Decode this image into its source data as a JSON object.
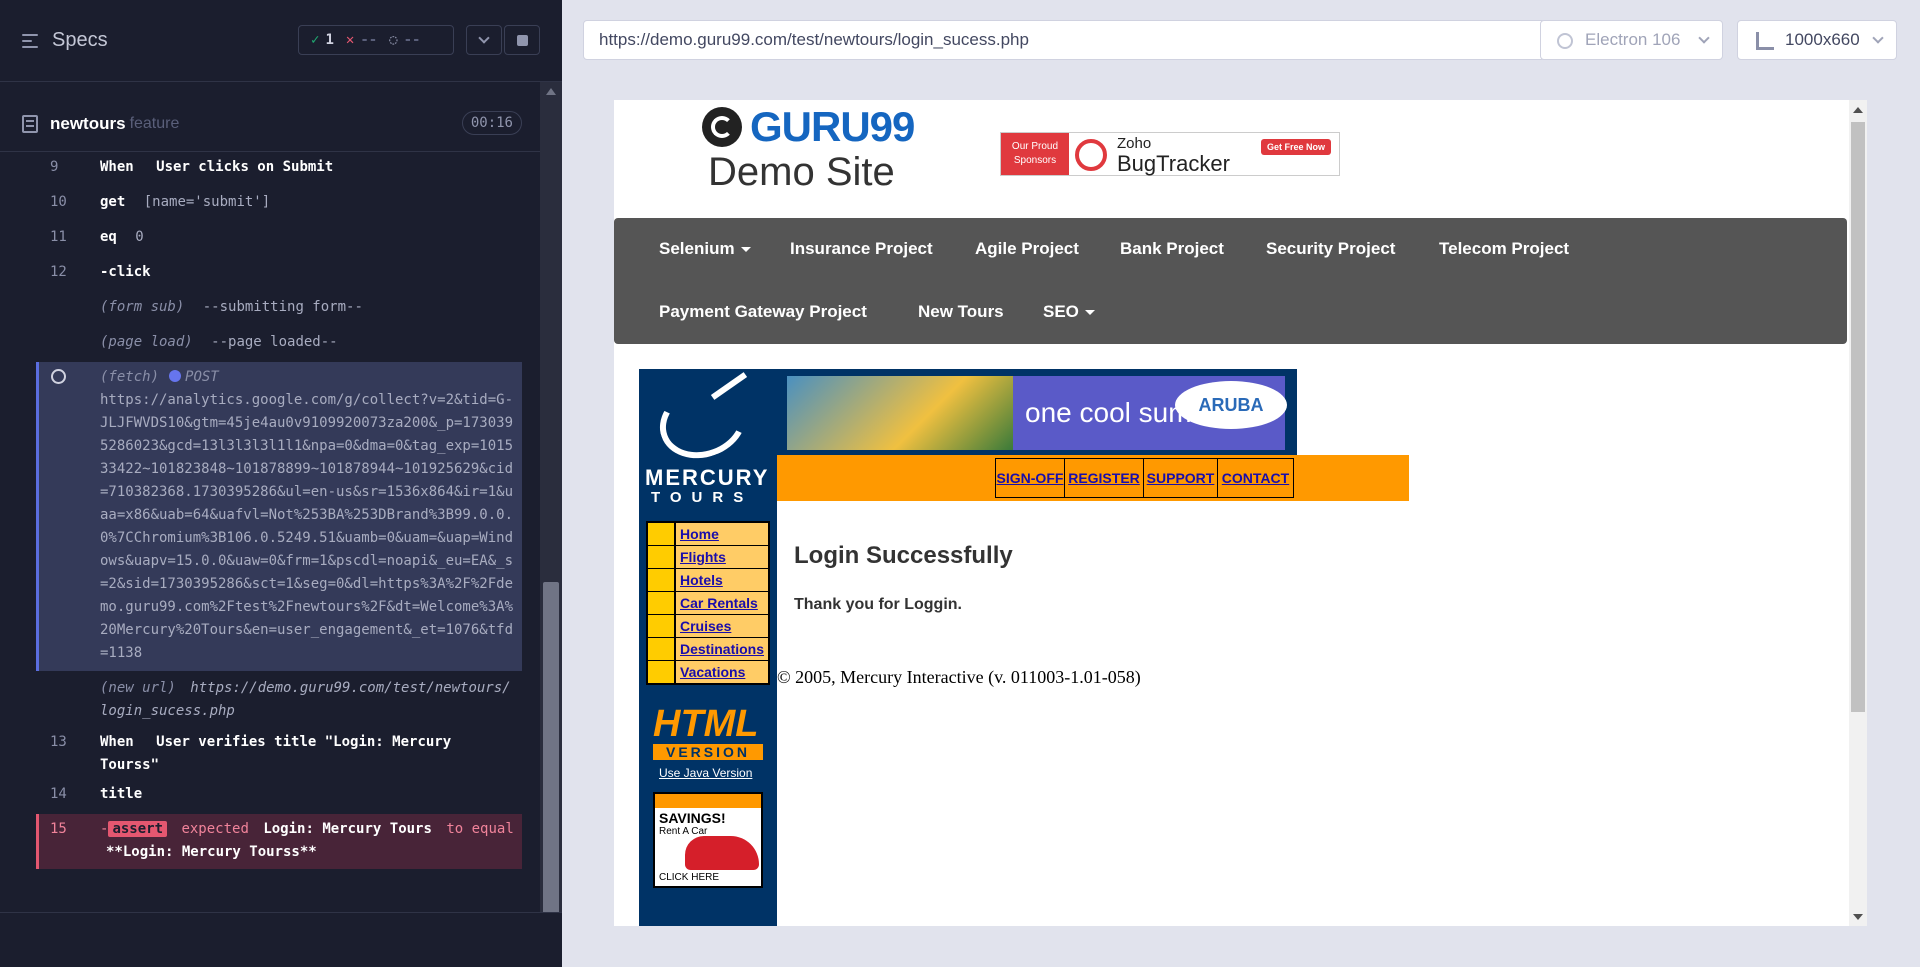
{
  "reporter": {
    "title": "Specs",
    "stats": {
      "passed": "1",
      "failed": "--",
      "pending": "--"
    },
    "spec": {
      "name": "newtours",
      "ext": "feature",
      "duration": "00:16"
    },
    "commands": [
      {
        "num": "9",
        "name": "When",
        "arg": "User clicks on Submit"
      },
      {
        "num": "10",
        "name": "get",
        "arg": "[name='submit']"
      },
      {
        "num": "11",
        "name": "eq",
        "arg": "0"
      },
      {
        "num": "12",
        "name": "-click",
        "arg": ""
      },
      {
        "label": "(form sub)",
        "arg": "--submitting form--"
      },
      {
        "label": "(page load)",
        "arg": "--page loaded--"
      }
    ],
    "fetch": {
      "label": "(fetch)",
      "method": "POST",
      "url": "https://analytics.google.com/g/collect?v=2&tid=G-JLJFWVDS10&gtm=45je4au0v9109920073za200&_p=1730395286023&gcd=13l3l3l3l1l1&npa=0&dma=0&tag_exp=101533422~101823848~101878899~101878944~101925629&cid=710382368.1730395286&ul=en-us&sr=1536x864&ir=1&uaa=x86&uab=64&uafvl=Not%253BA%253DBrand%3B99.0.0.0%7CChromium%3B106.0.5249.51&uamb=0&uam=&uap=Windows&uapv=15.0.0&uaw=0&frm=1&pscdl=noapi&_eu=EA&_s=2&sid=1730395286&sct=1&seg=0&dl=https%3A%2F%2Fdemo.guru99.com%2Ftest%2Fnewtours%2F&dt=Welcome%3A%20Mercury%20Tours&en=user_engagement&_et=1076&tfd=1138"
    },
    "new_url": {
      "label": "(new url)",
      "url": "https://demo.guru99.com/test/newtours/login_sucess.php"
    },
    "commands2": [
      {
        "num": "13",
        "name": "When",
        "arg": "User verifies title \"Login: Mercury Tourss\""
      },
      {
        "num": "14",
        "name": "title",
        "arg": ""
      }
    ],
    "assert": {
      "num": "15",
      "badge": "assert",
      "t1": "expected",
      "t2": "Login: Mercury Tours",
      "t3": "to equal",
      "t4": "**Login: Mercury Tourss**"
    }
  },
  "aut": {
    "url": "https://demo.guru99.com/test/newtours/login_sucess.php",
    "browser": "Electron 106",
    "viewport": "1000x660"
  },
  "site": {
    "logo": "GURU99",
    "demo": "Demo Site",
    "sponsor": {
      "proud": "Our Proud Sponsors",
      "z1": "Zoho",
      "z2": "BugTracker",
      "cta": "Get Free Now"
    },
    "nav": {
      "selenium": "Selenium",
      "insurance": "Insurance Project",
      "agile": "Agile Project",
      "bank": "Bank Project",
      "security": "Security Project",
      "telecom": "Telecom Project",
      "payment": "Payment Gateway Project",
      "newtours": "New Tours",
      "seo": "SEO"
    },
    "mercury": {
      "logo1": "MERCURY",
      "logo2": "TOURS",
      "banner": "one cool summer",
      "aruba": "ARUBA",
      "top_links": {
        "signoff": "SIGN-OFF",
        "register": "REGISTER",
        "support": "SUPPORT",
        "contact": "CONTACT"
      },
      "side_links": {
        "home": "Home",
        "flights": "Flights",
        "hotels": "Hotels",
        "car": "Car Rentals",
        "cruises": "Cruises",
        "dest": "Destinations",
        "vacations": "Vacations"
      },
      "html1": "HTML",
      "html2": "VERSION",
      "java": "Use Java Version",
      "savings1": "SAVINGS!",
      "savings2": "Rent A Car",
      "savings3": "CLICK HERE",
      "title": "Login Successfully",
      "message": "Thank you for Loggin.",
      "copyright": "© 2005, Mercury Interactive (v. 011003-1.01-058)"
    }
  }
}
